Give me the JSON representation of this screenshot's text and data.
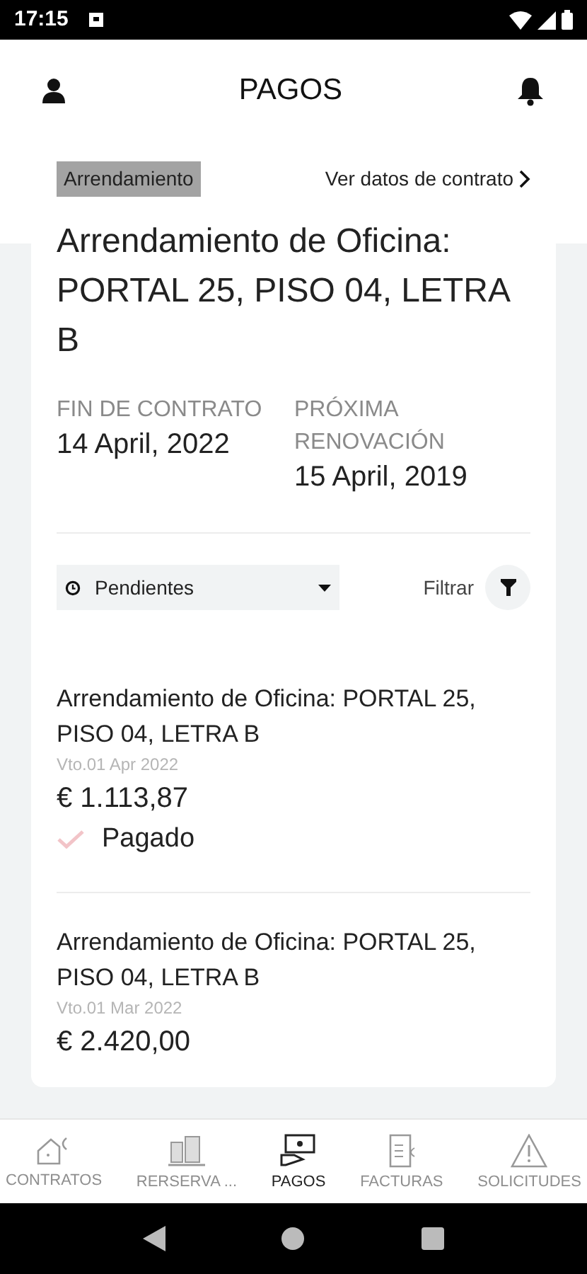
{
  "status_bar": {
    "time": "17:15"
  },
  "header": {
    "title": "PAGOS"
  },
  "contract": {
    "tag": "Arrendamiento",
    "link": "Ver datos de contrato",
    "title": "Arrendamiento de Oficina: PORTAL 25, PISO 04, LETRA B",
    "fields": [
      {
        "label": "FIN DE CONTRATO",
        "value": "14 April, 2022"
      },
      {
        "label": "PRÓXIMA RENOVACIÓN",
        "value": "15 April, 2019"
      }
    ]
  },
  "filter": {
    "dropdown": "Pendientes",
    "button": "Filtrar"
  },
  "payments": [
    {
      "title": "Arrendamiento de Oficina: PORTAL 25, PISO 04, LETRA B",
      "due": "Vto.01 Apr 2022",
      "amount": "€ 1.113,87",
      "status": "Pagado"
    },
    {
      "title": "Arrendamiento de Oficina: PORTAL 25, PISO 04, LETRA B",
      "due": "Vto.01 Mar 2022",
      "amount": "€ 2.420,00"
    }
  ],
  "bottom_nav": [
    {
      "label": "CONTRATOS",
      "kind": "house",
      "selected": false
    },
    {
      "label": "RERSERVA ...",
      "kind": "building",
      "selected": false
    },
    {
      "label": "PAGOS",
      "kind": "payment",
      "selected": true
    },
    {
      "label": "FACTURAS",
      "kind": "invoice",
      "selected": false
    },
    {
      "label": "SOLICITUDES",
      "kind": "warning",
      "selected": false
    }
  ]
}
